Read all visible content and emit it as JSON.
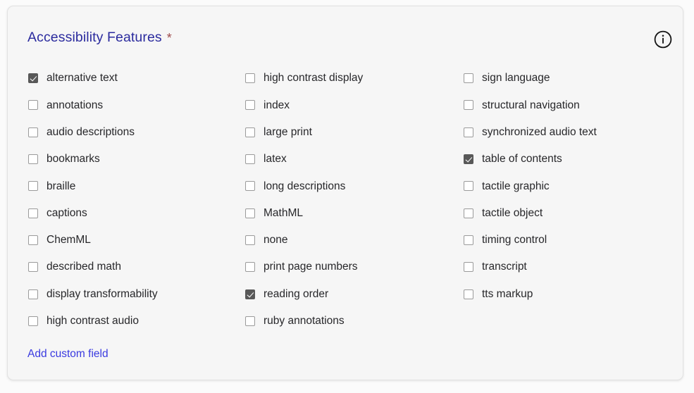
{
  "card": {
    "legend": "Accessibility Features",
    "required_marker": "*",
    "info_icon_name": "info-circle-icon",
    "add_custom_field_label": "Add custom field"
  },
  "colors": {
    "page_background": "#fbfbfb",
    "card_background": "#f6f6f6",
    "card_border": "#e2e2e2",
    "legend_text": "#2b2b9e",
    "required_marker": "#9e4a4a",
    "label_text": "#27272a",
    "checkbox_border": "#9b9b9b",
    "checkbox_checked_fill": "#585858",
    "checkbox_check_mark": "#ffffff",
    "link_text": "#3a3ae0"
  },
  "columns": [
    {
      "options": [
        {
          "label": "alternative text",
          "checked": true
        },
        {
          "label": "annotations",
          "checked": false
        },
        {
          "label": "audio descriptions",
          "checked": false
        },
        {
          "label": "bookmarks",
          "checked": false
        },
        {
          "label": "braille",
          "checked": false
        },
        {
          "label": "captions",
          "checked": false
        },
        {
          "label": "ChemML",
          "checked": false
        },
        {
          "label": "described math",
          "checked": false
        },
        {
          "label": "display transformability",
          "checked": false
        },
        {
          "label": "high contrast audio",
          "checked": false
        }
      ]
    },
    {
      "options": [
        {
          "label": "high contrast display",
          "checked": false
        },
        {
          "label": "index",
          "checked": false
        },
        {
          "label": "large print",
          "checked": false
        },
        {
          "label": "latex",
          "checked": false
        },
        {
          "label": "long descriptions",
          "checked": false
        },
        {
          "label": "MathML",
          "checked": false
        },
        {
          "label": "none",
          "checked": false
        },
        {
          "label": "print page numbers",
          "checked": false
        },
        {
          "label": "reading order",
          "checked": true
        },
        {
          "label": "ruby annotations",
          "checked": false
        }
      ]
    },
    {
      "options": [
        {
          "label": "sign language",
          "checked": false
        },
        {
          "label": "structural navigation",
          "checked": false
        },
        {
          "label": "synchronized audio text",
          "checked": false
        },
        {
          "label": "table of contents",
          "checked": true
        },
        {
          "label": "tactile graphic",
          "checked": false
        },
        {
          "label": "tactile object",
          "checked": false
        },
        {
          "label": "timing control",
          "checked": false
        },
        {
          "label": "transcript",
          "checked": false
        },
        {
          "label": "tts markup",
          "checked": false
        }
      ]
    }
  ]
}
